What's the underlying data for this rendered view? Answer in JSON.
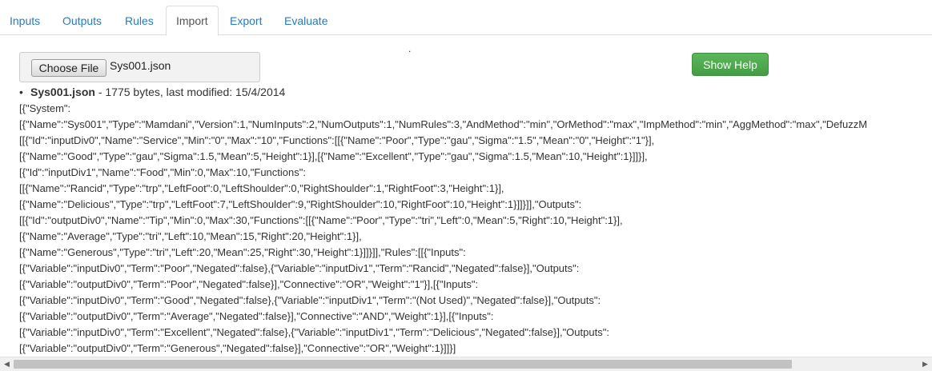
{
  "tabs": [
    {
      "label": "Inputs"
    },
    {
      "label": "Outputs"
    },
    {
      "label": "Rules"
    },
    {
      "label": "Import"
    },
    {
      "label": "Export"
    },
    {
      "label": "Evaluate"
    }
  ],
  "active_tab": "Import",
  "dot": ".",
  "file_input": {
    "button_label": "Choose File",
    "file_name": "Sys001.json"
  },
  "help_button": {
    "label": "Show Help"
  },
  "file_info": {
    "name": "Sys001.json",
    "details": " - 1775 bytes, last modified: 15/4/2014"
  },
  "json_lines": [
    "[{\"System\":",
    "[{\"Name\":\"Sys001\",\"Type\":\"Mamdani\",\"Version\":1,\"NumInputs\":2,\"NumOutputs\":1,\"NumRules\":3,\"AndMethod\":\"min\",\"OrMethod\":\"max\",\"ImpMethod\":\"min\",\"AggMethod\":\"max\",\"DefuzzM",
    "[[{\"Id\":\"inputDiv0\",\"Name\":\"Service\",\"Min\":\"0\",\"Max\":\"10\",\"Functions\":[[{\"Name\":\"Poor\",\"Type\":\"gau\",\"Sigma\":\"1.5\",\"Mean\":\"0\",\"Height\":\"1\"}],",
    "[{\"Name\":\"Good\",\"Type\":\"gau\",\"Sigma\":1.5,\"Mean\":5,\"Height\":1}],[{\"Name\":\"Excellent\",\"Type\":\"gau\",\"Sigma\":1.5,\"Mean\":10,\"Height\":1}]]}],",
    "[{\"Id\":\"inputDiv1\",\"Name\":\"Food\",\"Min\":0,\"Max\":10,\"Functions\":",
    "[[{\"Name\":\"Rancid\",\"Type\":\"trp\",\"LeftFoot\":0,\"LeftShoulder\":0,\"RightShoulder\":1,\"RightFoot\":3,\"Height\":1}],",
    "[{\"Name\":\"Delicious\",\"Type\":\"trp\",\"LeftFoot\":7,\"LeftShoulder\":9,\"RightShoulder\":10,\"RightFoot\":10,\"Height\":1}]]}]],\"Outputs\":",
    "[[{\"Id\":\"outputDiv0\",\"Name\":\"Tip\",\"Min\":0,\"Max\":30,\"Functions\":[[{\"Name\":\"Poor\",\"Type\":\"tri\",\"Left\":0,\"Mean\":5,\"Right\":10,\"Height\":1}],",
    "[{\"Name\":\"Average\",\"Type\":\"tri\",\"Left\":10,\"Mean\":15,\"Right\":20,\"Height\":1}],",
    "[{\"Name\":\"Generous\",\"Type\":\"tri\",\"Left\":20,\"Mean\":25,\"Right\":30,\"Height\":1}]]}]],\"Rules\":[[{\"Inputs\":",
    "[{\"Variable\":\"inputDiv0\",\"Term\":\"Poor\",\"Negated\":false},{\"Variable\":\"inputDiv1\",\"Term\":\"Rancid\",\"Negated\":false}],\"Outputs\":",
    "[{\"Variable\":\"outputDiv0\",\"Term\":\"Poor\",\"Negated\":false}],\"Connective\":\"OR\",\"Weight\":\"1\"}],[{\"Inputs\":",
    "[{\"Variable\":\"inputDiv0\",\"Term\":\"Good\",\"Negated\":false},{\"Variable\":\"inputDiv1\",\"Term\":\"(Not Used)\",\"Negated\":false}],\"Outputs\":",
    "[{\"Variable\":\"outputDiv0\",\"Term\":\"Average\",\"Negated\":false}],\"Connective\":\"AND\",\"Weight\":1}],[{\"Inputs\":",
    "[{\"Variable\":\"inputDiv0\",\"Term\":\"Excellent\",\"Negated\":false},{\"Variable\":\"inputDiv1\",\"Term\":\"Delicious\",\"Negated\":false}],\"Outputs\":",
    "[{\"Variable\":\"outputDiv0\",\"Term\":\"Generous\",\"Negated\":false}],\"Connective\":\"OR\",\"Weight\":1}]]}]"
  ],
  "scrollbar": {
    "left_arrow": "◀",
    "right_arrow": "▶"
  },
  "colors": {
    "link": "#2a7ab8",
    "help_button": "#5cb85c"
  }
}
